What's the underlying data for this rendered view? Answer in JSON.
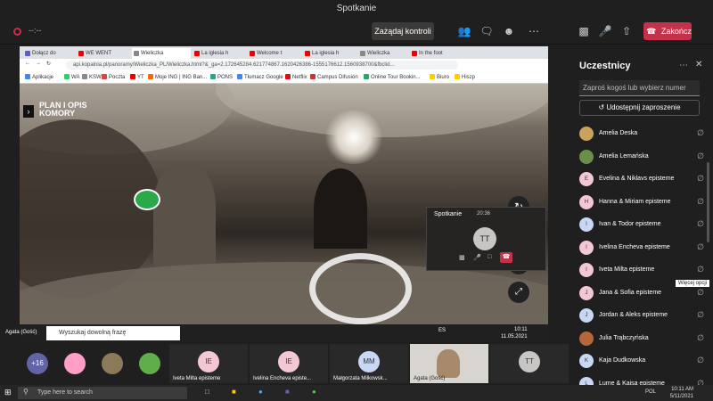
{
  "window": {
    "title": "Spotkanie"
  },
  "toolbar": {
    "timer": "--:--",
    "control_label": "Zażądaj kontroli",
    "leave_label": "Zakończ"
  },
  "browser": {
    "tabs": [
      "Dołącz do",
      "WE WENT",
      "Wieliczka",
      "La iglesia h",
      "Welcome t",
      "La iglesia h",
      "Wieliczka",
      "In the foot"
    ],
    "url": "api.kopalnia.pl/panoramy/Wieliczka_PL/Wieliczka.html?&_ga=2.172645284.621774867.1620426386-1555176612.1560938700&fbclid...",
    "bookmarks": [
      "Aplikacje",
      "WA",
      "KSW",
      "Poczta",
      "YT",
      "Moje ING | ING Ban...",
      "PONS",
      "Tłumacz Google",
      "Netflix",
      "Campus Difusión",
      "Online Tour Bookin...",
      "Biuro",
      "Hiszp"
    ]
  },
  "panorama": {
    "title_line1": "PLAN I OPIS",
    "title_line2": "KOMORY"
  },
  "inner_taskbar": {
    "search_placeholder": "Wyszukaj dowolną frazę",
    "time": "10:11",
    "date": "11.05.2021",
    "lang": "ES"
  },
  "mini_call": {
    "title": "Spotkanie",
    "time": "20:36",
    "initials": "TT"
  },
  "panel": {
    "title": "Uczestnicy",
    "search_placeholder": "Zaproś kogoś lub wybierz numer",
    "share_label": "Udostępnij zaproszenie",
    "tooltip": "Więcej opcji",
    "participants": [
      {
        "name": "Amelia Deska",
        "initials": "",
        "color": "#c9a35a"
      },
      {
        "name": "Amelia Lemańska",
        "initials": "",
        "color": "#6a8f4a"
      },
      {
        "name": "Evelina & Niklavs episteme",
        "initials": "E",
        "color": "#f4c7d4"
      },
      {
        "name": "Hanna & Miriam episteme",
        "initials": "H",
        "color": "#f4c7d4"
      },
      {
        "name": "Ivan & Todor episteme",
        "initials": "I",
        "color": "#c7d7f4"
      },
      {
        "name": "Ivelina Encheva episteme",
        "initials": "I",
        "color": "#f4c7d4"
      },
      {
        "name": "Iveta Milta episteme",
        "initials": "I",
        "color": "#f4c7d4"
      },
      {
        "name": "Jana & Sofia episteme",
        "initials": "J",
        "color": "#f4c7d4"
      },
      {
        "name": "Jordan & Aleks episteme",
        "initials": "J",
        "color": "#c7d7f4"
      },
      {
        "name": "Julia Trąbczyńska",
        "initials": "",
        "color": "#b5673c"
      },
      {
        "name": "Kaja Dudkowska",
        "initials": "K",
        "color": "#c7d7f4"
      },
      {
        "name": "Lume & Kaisa episteme",
        "initials": "L",
        "color": "#c7d7f4"
      }
    ]
  },
  "stage": {
    "presenter": "Agata (Gość)",
    "overflow": "+16",
    "tiles": [
      {
        "initials": "IE",
        "name": "Iveta Milta episteme"
      },
      {
        "initials": "IE",
        "name": "Ivelina Encheva episte..."
      },
      {
        "initials": "MM",
        "name": "Małgorzata Milkowsk..."
      },
      {
        "initials": "",
        "name": "Agata (Gość)"
      },
      {
        "initials": "TT",
        "name": ""
      }
    ]
  },
  "windows_taskbar": {
    "search_placeholder": "Type here to search",
    "time": "10:11 AM",
    "date": "5/11/2021",
    "lang": "POL"
  },
  "colors": {
    "accent": "#6264a7",
    "danger": "#c4314b"
  }
}
